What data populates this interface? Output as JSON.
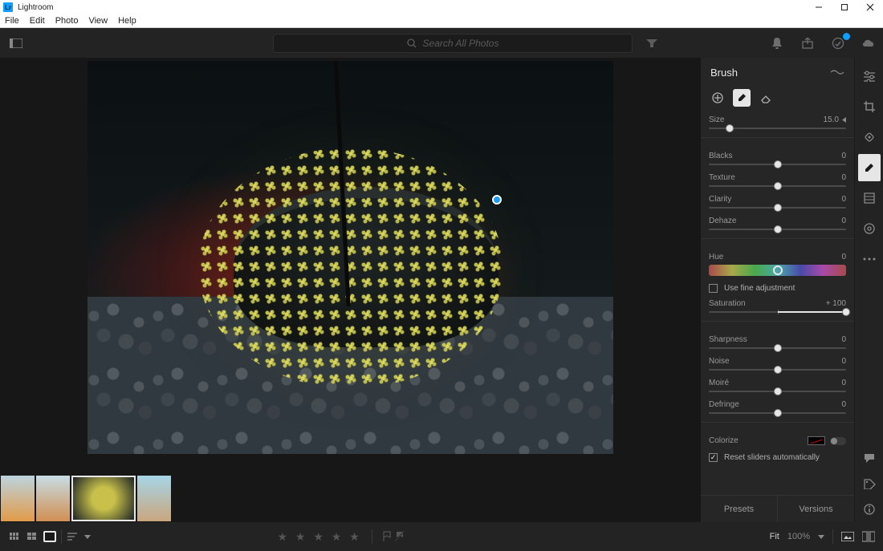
{
  "titlebar": {
    "app": "Lightroom"
  },
  "menu": [
    "File",
    "Edit",
    "Photo",
    "View",
    "Help"
  ],
  "toolbar": {
    "search_placeholder": "Search All Photos"
  },
  "panel": {
    "title": "Brush",
    "size": {
      "label": "Size",
      "value": "15.0"
    },
    "blacks": {
      "label": "Blacks",
      "value": "0"
    },
    "texture": {
      "label": "Texture",
      "value": "0"
    },
    "clarity": {
      "label": "Clarity",
      "value": "0"
    },
    "dehaze": {
      "label": "Dehaze",
      "value": "0"
    },
    "hue": {
      "label": "Hue",
      "value": "0"
    },
    "fine_adjust": "Use fine adjustment",
    "saturation": {
      "label": "Saturation",
      "value": "+ 100"
    },
    "sharpness": {
      "label": "Sharpness",
      "value": "0"
    },
    "noise": {
      "label": "Noise",
      "value": "0"
    },
    "moire": {
      "label": "Moiré",
      "value": "0"
    },
    "defringe": {
      "label": "Defringe",
      "value": "0"
    },
    "colorize": "Colorize",
    "reset_sliders": "Reset sliders automatically",
    "tabs": {
      "presets": "Presets",
      "versions": "Versions"
    }
  },
  "bottombar": {
    "fit": "Fit",
    "zoom": "100%"
  }
}
